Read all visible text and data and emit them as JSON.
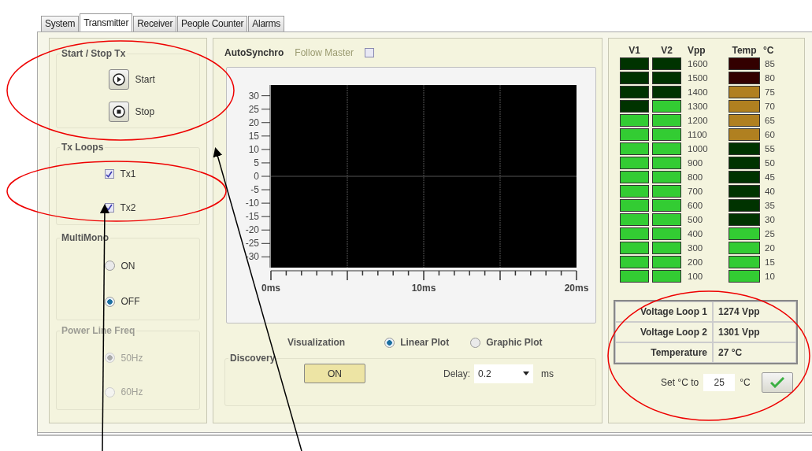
{
  "tabs": [
    {
      "label": "System",
      "selected": false
    },
    {
      "label": "Transmitter",
      "selected": true
    },
    {
      "label": "Receiver",
      "selected": false
    },
    {
      "label": "People Counter",
      "selected": false
    },
    {
      "label": "Alarms",
      "selected": false
    }
  ],
  "start_stop": {
    "title": "Start / Stop Tx",
    "buttons": [
      {
        "kind": "play",
        "label": "Start"
      },
      {
        "kind": "stop",
        "label": "Stop"
      }
    ]
  },
  "tx_loops": {
    "title": "Tx Loops",
    "items": [
      {
        "label": "Tx1",
        "checked": true
      },
      {
        "label": "Tx2",
        "checked": true
      }
    ]
  },
  "multimono": {
    "title": "MultiMono",
    "disabled": false,
    "options": [
      {
        "label": "ON",
        "selected": false
      },
      {
        "label": "OFF",
        "selected": true
      }
    ]
  },
  "power_line_freq": {
    "title": "Power Line Freq",
    "disabled": true,
    "options": [
      {
        "label": "50Hz",
        "selected": true
      },
      {
        "label": "60Hz",
        "selected": false
      }
    ]
  },
  "auto_synchro": {
    "title": "AutoSynchro",
    "follow_master": {
      "label": "Follow Master",
      "checked": false
    },
    "chart_data": {
      "type": "line",
      "xlim": [
        0,
        20
      ],
      "ylim": [
        -34,
        34
      ],
      "xticks": [
        {
          "value": 0,
          "label": "0ms"
        },
        {
          "value": 10,
          "label": "10ms"
        },
        {
          "value": 20,
          "label": "20ms"
        }
      ],
      "yticks": [
        30,
        25,
        20,
        15,
        10,
        5,
        0,
        -5,
        -10,
        -15,
        -20,
        -25,
        -30
      ]
    },
    "visualization": {
      "label": "Visualization",
      "options": [
        {
          "label": "Linear Plot",
          "selected": true
        },
        {
          "label": "Graphic Plot",
          "selected": false
        }
      ]
    },
    "discovery": {
      "title": "Discovery",
      "button": "ON",
      "delay_label": "Delay:",
      "delay_value": "0.2",
      "delay_unit": "ms"
    }
  },
  "meters": {
    "headers": {
      "v1": "V1",
      "v2": "V2",
      "vpp": "Vpp",
      "temp": "Temp",
      "temp_unit": "°C"
    },
    "rows": [
      {
        "segments": [
          {
            "color": "#003300"
          },
          {
            "color": "#003300"
          }
        ],
        "vpp": "1600",
        "temp_segment": {
          "color": "#330000"
        },
        "temp": "85"
      },
      {
        "segments": [
          {
            "color": "#003300"
          },
          {
            "color": "#003300"
          }
        ],
        "vpp": "1500",
        "temp_segment": {
          "color": "#330000"
        },
        "temp": "80"
      },
      {
        "segments": [
          {
            "color": "#003300"
          },
          {
            "color": "#003300"
          }
        ],
        "vpp": "1400",
        "temp_segment": {
          "color": "#b08020"
        },
        "temp": "75"
      },
      {
        "segments": [
          {
            "color": "#003300"
          },
          {
            "color": "#33cc33"
          }
        ],
        "vpp": "1300",
        "temp_segment": {
          "color": "#b08020"
        },
        "temp": "70"
      },
      {
        "segments": [
          {
            "color": "#33cc33"
          },
          {
            "color": "#33cc33"
          }
        ],
        "vpp": "1200",
        "temp_segment": {
          "color": "#b08020"
        },
        "temp": "65"
      },
      {
        "segments": [
          {
            "color": "#33cc33"
          },
          {
            "color": "#33cc33"
          }
        ],
        "vpp": "1100",
        "temp_segment": {
          "color": "#b08020"
        },
        "temp": "60"
      },
      {
        "segments": [
          {
            "color": "#33cc33"
          },
          {
            "color": "#33cc33"
          }
        ],
        "vpp": "1000",
        "temp_segment": {
          "color": "#003300"
        },
        "temp": "55"
      },
      {
        "segments": [
          {
            "color": "#33cc33"
          },
          {
            "color": "#33cc33"
          }
        ],
        "vpp": "900",
        "temp_segment": {
          "color": "#003300"
        },
        "temp": "50"
      },
      {
        "segments": [
          {
            "color": "#33cc33"
          },
          {
            "color": "#33cc33"
          }
        ],
        "vpp": "800",
        "temp_segment": {
          "color": "#003300"
        },
        "temp": "45"
      },
      {
        "segments": [
          {
            "color": "#33cc33"
          },
          {
            "color": "#33cc33"
          }
        ],
        "vpp": "700",
        "temp_segment": {
          "color": "#003300"
        },
        "temp": "40"
      },
      {
        "segments": [
          {
            "color": "#33cc33"
          },
          {
            "color": "#33cc33"
          }
        ],
        "vpp": "600",
        "temp_segment": {
          "color": "#003300"
        },
        "temp": "35"
      },
      {
        "segments": [
          {
            "color": "#33cc33"
          },
          {
            "color": "#33cc33"
          }
        ],
        "vpp": "500",
        "temp_segment": {
          "color": "#003300"
        },
        "temp": "30"
      },
      {
        "segments": [
          {
            "color": "#33cc33"
          },
          {
            "color": "#33cc33"
          }
        ],
        "vpp": "400",
        "temp_segment": {
          "color": "#33cc33"
        },
        "temp": "25"
      },
      {
        "segments": [
          {
            "color": "#33cc33"
          },
          {
            "color": "#33cc33"
          }
        ],
        "vpp": "300",
        "temp_segment": {
          "color": "#33cc33"
        },
        "temp": "20"
      },
      {
        "segments": [
          {
            "color": "#33cc33"
          },
          {
            "color": "#33cc33"
          }
        ],
        "vpp": "200",
        "temp_segment": {
          "color": "#33cc33"
        },
        "temp": "15"
      },
      {
        "segments": [
          {
            "color": "#33cc33"
          },
          {
            "color": "#33cc33"
          }
        ],
        "vpp": "100",
        "temp_segment": {
          "color": "#33cc33"
        },
        "temp": "10"
      }
    ]
  },
  "readings": [
    {
      "label": "Voltage Loop 1",
      "value": "1274 Vpp"
    },
    {
      "label": "Voltage Loop 2",
      "value": "1301 Vpp"
    },
    {
      "label": "Temperature",
      "value": "27 °C"
    }
  ],
  "set_temp": {
    "label": "Set °C to",
    "value": "25",
    "unit": "°C"
  }
}
